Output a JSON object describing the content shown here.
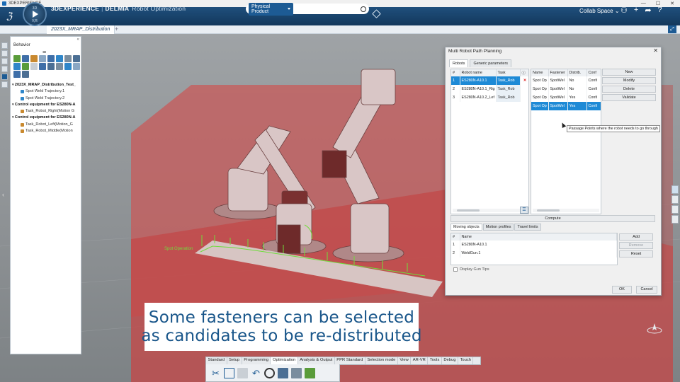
{
  "os": {
    "title": "3DEXPERIENCE",
    "controls": [
      "—",
      "☐",
      "✕"
    ]
  },
  "topbar": {
    "brand_bold": "3DEXPERIENCE",
    "brand_sep": "|",
    "brand_name": "DELMIA",
    "app_name": "Robot Optimization",
    "compass_top": "3D",
    "compass_ver": "V,R",
    "search_scope": "Physical Product",
    "search_placeholder": "",
    "collab_space": "Collab Space",
    "icons": [
      "user-icon",
      "add-icon",
      "share-icon",
      "help-icon"
    ]
  },
  "tabs": {
    "active": "2023X_MRAP_Distribution",
    "add": "+"
  },
  "left_panel": {
    "tab": "Behavior",
    "grip": "•••",
    "close": "«",
    "tree": [
      {
        "type": "grp",
        "label": "2023X_MRAP_Distribution_Test_"
      },
      {
        "type": "leaf",
        "label": "Spot Weld Trajectory.1",
        "color": "#2f86c9"
      },
      {
        "type": "leaf",
        "label": "Spot Weld Trajectory.2",
        "color": "#2f86c9"
      },
      {
        "type": "grp",
        "label": "Control equipment for ES280N-A"
      },
      {
        "type": "leaf",
        "label": "Task_Robot_Right(Motion G",
        "color": "#c9892f"
      },
      {
        "type": "grp",
        "label": "Control equipment for ES280N-A"
      },
      {
        "type": "leaf",
        "label": "Task_Robot_Left(Motion_G",
        "color": "#c9892f"
      },
      {
        "type": "leaf",
        "label": "Task_Robot_Middle(Motion",
        "color": "#c9892f"
      }
    ]
  },
  "dialog": {
    "title": "Multi Robot Path Planning",
    "close": "✕",
    "tabs": [
      "Robots",
      "Generic parameters"
    ],
    "robots": {
      "headers": [
        "#",
        "Robot name",
        "Task"
      ],
      "rows": [
        {
          "n": "1",
          "name": "ES280N-A10.1",
          "task": "Task_Rob",
          "selected": true
        },
        {
          "n": "2",
          "name": "ES280N-A10.1_Rig",
          "task": "Task_Rob",
          "selected": false
        },
        {
          "n": "3",
          "name": "ES280N-A10.2_Lef",
          "task": "Task_Rob",
          "selected": false
        }
      ]
    },
    "fasteners": {
      "headers": [
        "Name",
        "Fastener",
        "Distrib.",
        "Conf"
      ],
      "rows": [
        {
          "name": "Spot Op",
          "fastener": "SpotWel",
          "distrib": "No",
          "conf": "Confi",
          "selected": false
        },
        {
          "name": "Spot Op",
          "fastener": "SpotWel",
          "distrib": "No",
          "conf": "Confi",
          "selected": false
        },
        {
          "name": "Spot Op",
          "fastener": "SpotWel",
          "distrib": "Yes",
          "conf": "Confi",
          "selected": false
        },
        {
          "name": "Spot Op",
          "fastener": "SpotWel",
          "distrib": "Yes",
          "conf": "Confi",
          "selected": true
        }
      ]
    },
    "buttons": [
      "New",
      "Modify",
      "Delete",
      "Validate"
    ],
    "tooltip": "Passage Points where the robot needs to go through",
    "compute": "Compute",
    "sub_tabs": [
      "Moving objects",
      "Motion profiles",
      "Travel limits"
    ],
    "moving": {
      "headers": [
        "#",
        "Name"
      ],
      "rows": [
        {
          "n": "1",
          "name": "ES280N-A10.1"
        },
        {
          "n": "2",
          "name": "WeldGun.1"
        }
      ]
    },
    "moving_buttons": {
      "add": "Add",
      "remove": "Remove",
      "reset": "Reset"
    },
    "display_gun_tips": "Display Gun Tips",
    "ok": "OK",
    "cancel": "Cancel"
  },
  "scene": {
    "label": "Spot Operation"
  },
  "caption": {
    "line1": "Some fasteners can be selected",
    "line2": "as candidates to be re-distributed"
  },
  "actionbar": {
    "tabs": [
      "Standard",
      "Setup",
      "Programming",
      "Optimization",
      "Analysis & Output",
      "PPR Standard",
      "Selection mode",
      "View",
      "AR-VR",
      "Tools",
      "Debug",
      "Touch"
    ],
    "active": "Optimization"
  },
  "colors": {
    "brand": "#13385c",
    "selection": "#1e8ad6",
    "caption_text": "#19568a",
    "zone": "#c85050"
  }
}
